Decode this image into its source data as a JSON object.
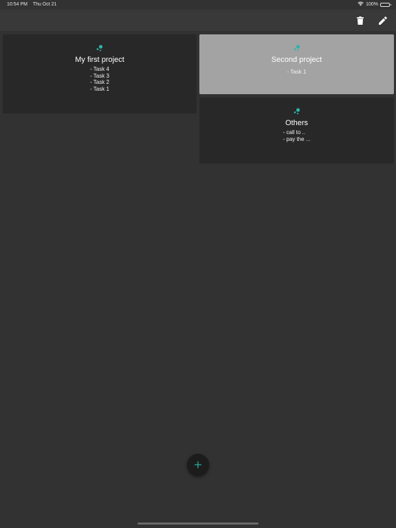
{
  "status_bar": {
    "time": "10:54 PM",
    "date": "Thu Oct 21",
    "battery": "100%",
    "battery_level": 1.0
  },
  "toolbar": {
    "delete_icon": "trash-icon",
    "edit_icon": "pencil-icon"
  },
  "colors": {
    "background": "#323232",
    "toolbar": "#393939",
    "card": "#282828",
    "card_selected": "#a3a3a3",
    "accent": "#2bb5a8"
  },
  "projects": [
    {
      "title": "My first project",
      "icon": "molecule-icon",
      "selected": false,
      "tasks": [
        "- Task 4",
        "- Task 3",
        "- Task 2",
        "- Task 1"
      ]
    },
    {
      "title": "Second project",
      "icon": "molecule-icon",
      "selected": true,
      "tasks": [
        "- Task 1"
      ]
    },
    {
      "title": "Others",
      "icon": "molecule-icon",
      "selected": false,
      "tasks": [
        "- call to ..",
        "- pay the ..."
      ]
    }
  ],
  "fab": {
    "icon": "plus-icon"
  }
}
